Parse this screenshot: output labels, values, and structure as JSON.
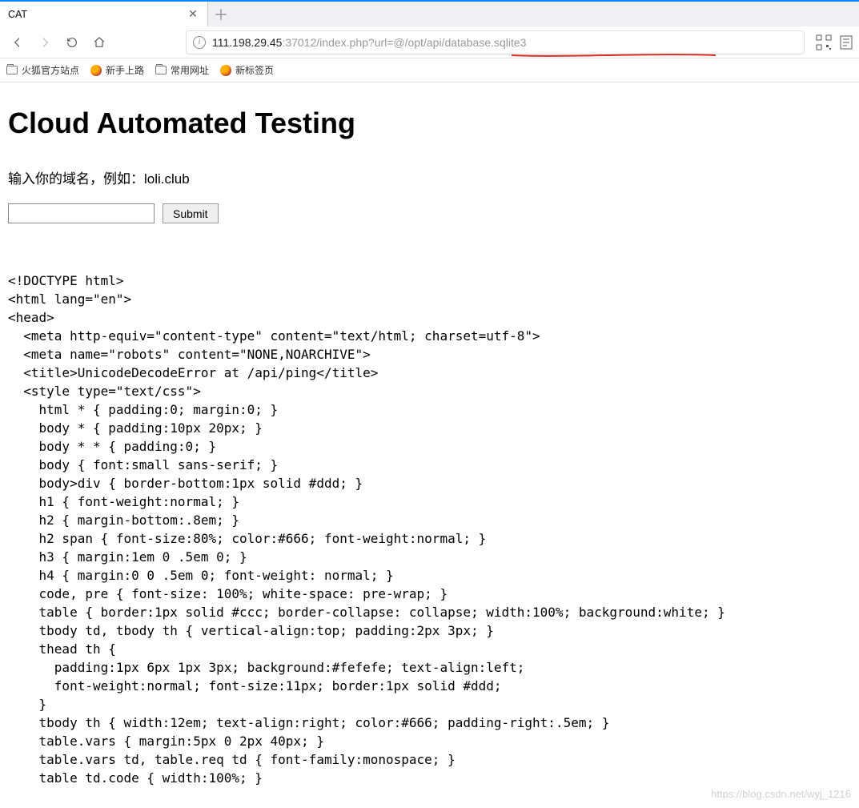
{
  "browser": {
    "tab_title": "CAT",
    "url_host": "111.198.29.45",
    "url_port": ":37012",
    "url_path": "/index.php?",
    "url_query": "url=@/opt/api/database.sqlite3"
  },
  "bookmarks": [
    {
      "kind": "folder",
      "label": "火狐官方站点"
    },
    {
      "kind": "globe",
      "label": "新手上路"
    },
    {
      "kind": "folder",
      "label": "常用网址"
    },
    {
      "kind": "globe",
      "label": "新标签页"
    }
  ],
  "page": {
    "title": "Cloud Automated Testing",
    "intro": "输入你的域名，例如：loli.club",
    "submit_label": "Submit"
  },
  "source_lines": [
    "<!DOCTYPE html>",
    "<html lang=\"en\">",
    "<head>",
    "  <meta http-equiv=\"content-type\" content=\"text/html; charset=utf-8\">",
    "  <meta name=\"robots\" content=\"NONE,NOARCHIVE\">",
    "  <title>UnicodeDecodeError at /api/ping</title>",
    "  <style type=\"text/css\">",
    "    html * { padding:0; margin:0; }",
    "    body * { padding:10px 20px; }",
    "    body * * { padding:0; }",
    "    body { font:small sans-serif; }",
    "    body>div { border-bottom:1px solid #ddd; }",
    "    h1 { font-weight:normal; }",
    "    h2 { margin-bottom:.8em; }",
    "    h2 span { font-size:80%; color:#666; font-weight:normal; }",
    "    h3 { margin:1em 0 .5em 0; }",
    "    h4 { margin:0 0 .5em 0; font-weight: normal; }",
    "    code, pre { font-size: 100%; white-space: pre-wrap; }",
    "    table { border:1px solid #ccc; border-collapse: collapse; width:100%; background:white; }",
    "    tbody td, tbody th { vertical-align:top; padding:2px 3px; }",
    "    thead th {",
    "      padding:1px 6px 1px 3px; background:#fefefe; text-align:left;",
    "      font-weight:normal; font-size:11px; border:1px solid #ddd;",
    "    }",
    "    tbody th { width:12em; text-align:right; color:#666; padding-right:.5em; }",
    "    table.vars { margin:5px 0 2px 40px; }",
    "    table.vars td, table.req td { font-family:monospace; }",
    "    table td.code { width:100%; }"
  ],
  "watermark": "https://blog.csdn.net/wyj_1216"
}
